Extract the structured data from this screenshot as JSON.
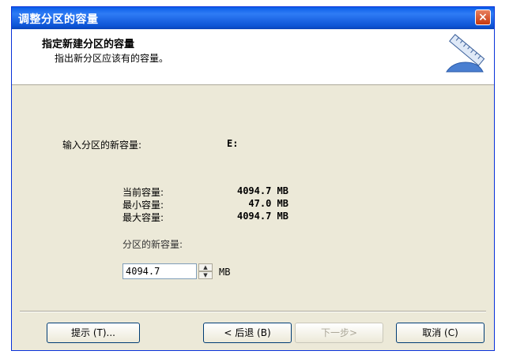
{
  "window": {
    "title": "调整分区的容量",
    "close_glyph": "×"
  },
  "header": {
    "title": "指定新建分区的容量",
    "subtitle": "指出新分区应该有的容量。",
    "icon": "ruler-icon"
  },
  "body": {
    "prompt_label": "输入分区的新容量:",
    "drive": "E:",
    "current_label": "当前容量:",
    "current_value": "4094.7 MB",
    "min_label": "最小容量:",
    "min_value": "47.0 MB",
    "max_label": "最大容量:",
    "max_value": "4094.7 MB",
    "new_label": "分区的新容量:",
    "new_value": "4094.7",
    "unit": "MB"
  },
  "buttons": {
    "hint": "提示 (T)...",
    "back": "< 后退 (B)",
    "next": "下一步>",
    "cancel": "取消 (C)"
  },
  "colors": {
    "titlebar": "#0a5ee8",
    "dialog": "#ece9d8"
  }
}
